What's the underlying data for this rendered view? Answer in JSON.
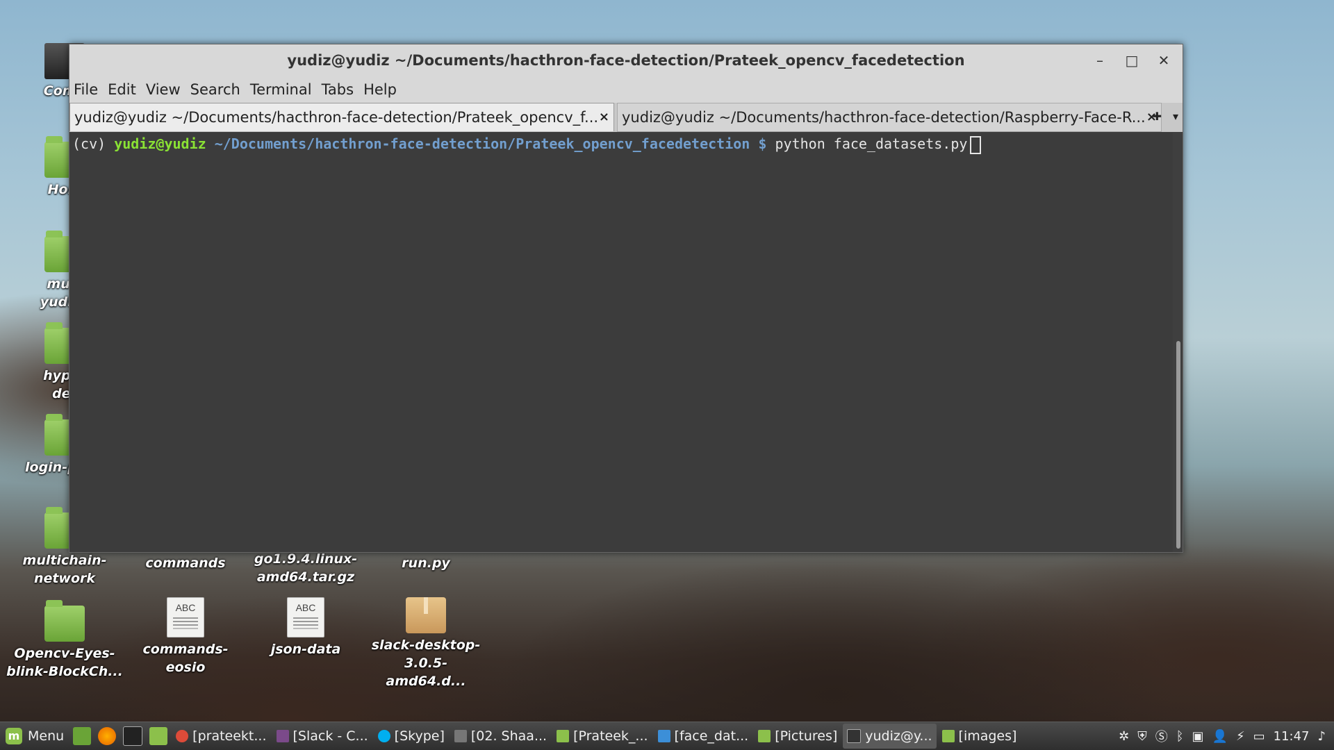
{
  "desktop": {
    "icons": [
      {
        "label": "Comp",
        "type": "computer"
      },
      {
        "label": "Hom",
        "type": "folder"
      },
      {
        "label": "musi\nyudizn",
        "type": "folder"
      },
      {
        "label": "hyper\nder",
        "type": "folder"
      },
      {
        "label": "login-page",
        "type": "folder"
      },
      {
        "label": "multichain-\nnetwork",
        "type": "folder"
      },
      {
        "label": "Opencv-Eyes-\nblink-BlockCh...",
        "type": "folder"
      },
      {
        "label": "commands",
        "type": "doc"
      },
      {
        "label": "go1.9.4.linux-\namd64.tar.gz",
        "type": "pkg"
      },
      {
        "label": "run.py",
        "type": "doc"
      },
      {
        "label": "commands-\neosio",
        "type": "doc"
      },
      {
        "label": "json-data",
        "type": "doc"
      },
      {
        "label": "slack-desktop-\n3.0.5-amd64.d...",
        "type": "pkg"
      }
    ]
  },
  "window": {
    "title": "yudiz@yudiz ~/Documents/hacthron-face-detection/Prateek_opencv_facedetection",
    "minimize": "–",
    "maximize": "□",
    "close": "✕",
    "menu": [
      "File",
      "Edit",
      "View",
      "Search",
      "Terminal",
      "Tabs",
      "Help"
    ],
    "tabs": [
      {
        "label": "yudiz@yudiz ~/Documents/hacthron-face-detection/Prateek_opencv_f...",
        "active": true
      },
      {
        "label": "yudiz@yudiz ~/Documents/hacthron-face-detection/Raspberry-Face-R...",
        "active": false
      }
    ],
    "tab_close": "×",
    "tab_new": "✚",
    "tab_menu": "▾",
    "terminal": {
      "env": "(cv)",
      "user_host": "yudiz@yudiz",
      "path": "~/Documents/hacthron-face-detection/Prateek_opencv_facedetection",
      "prompt": "$",
      "command": "python face_datasets.py"
    }
  },
  "taskbar": {
    "menu_label": "Menu",
    "windows": [
      {
        "label": "[prateekt...",
        "color": "#dd4b39"
      },
      {
        "label": "[Slack - C...",
        "color": "#7b4a8a"
      },
      {
        "label": "[Skype]",
        "color": "#00aff0"
      },
      {
        "label": "[02. Shaa...",
        "color": "#777777"
      },
      {
        "label": "[Prateek_...",
        "color": "#8cc04b"
      },
      {
        "label": "[face_dat...",
        "color": "#3c8fd8"
      },
      {
        "label": "[Pictures]",
        "color": "#8cc04b"
      },
      {
        "label": "yudiz@y...",
        "color": "#333333",
        "active": true
      },
      {
        "label": "[images]",
        "color": "#8cc04b"
      }
    ],
    "clock": "11:47"
  }
}
